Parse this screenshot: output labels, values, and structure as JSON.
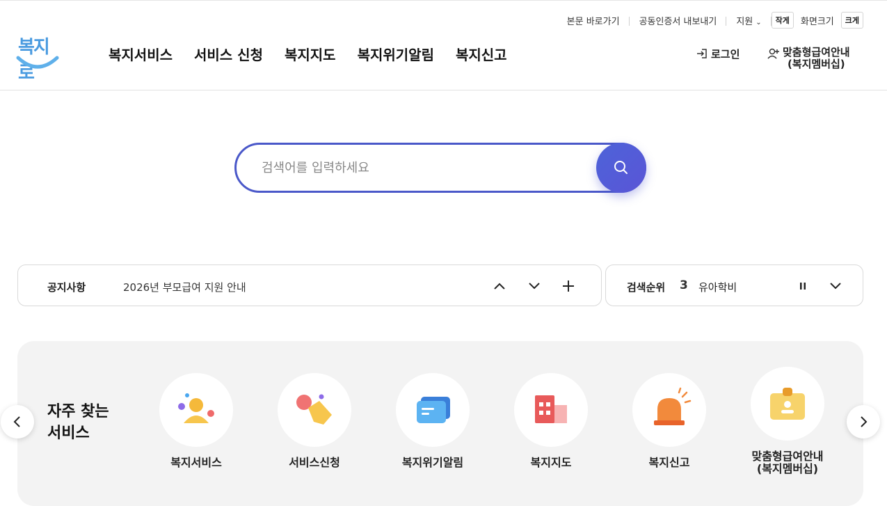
{
  "utility": {
    "skip": "본문 바로가기",
    "cert": "공동인증서 내보내기",
    "support": "지원",
    "small": "작게",
    "screen_size": "화면크기",
    "large": "크게"
  },
  "logo": {
    "text": "복지로"
  },
  "gnb": [
    "복지서비스",
    "서비스 신청",
    "복지지도",
    "복지위기알림",
    "복지신고"
  ],
  "member": {
    "login": "로그인",
    "membership_line1": "맞춤형급여안내",
    "membership_line2": "(복지멤버십)"
  },
  "search": {
    "placeholder": "검색어를 입력하세요"
  },
  "notice": {
    "label": "공지사항",
    "text": "2026년 부모급여 지원 안내"
  },
  "rank": {
    "label": "검색순위",
    "number": "3",
    "keyword": "유아학비"
  },
  "quick": {
    "title_line1": "자주 찾는",
    "title_line2": "서비스",
    "services": [
      {
        "name": "복지서비스",
        "icon": "person-icon"
      },
      {
        "name": "서비스신청",
        "icon": "hand-touch-icon"
      },
      {
        "name": "복지위기알림",
        "icon": "chat-bubble-icon"
      },
      {
        "name": "복지지도",
        "icon": "building-icon"
      },
      {
        "name": "복지신고",
        "icon": "siren-icon"
      },
      {
        "name": "맞춤형급여안내\n(복지멤버십)",
        "icon": "id-card-icon"
      }
    ]
  },
  "colors": {
    "accent": "#4a58c9",
    "logo": "#4a9be0",
    "panel": "#f3f3f3"
  }
}
